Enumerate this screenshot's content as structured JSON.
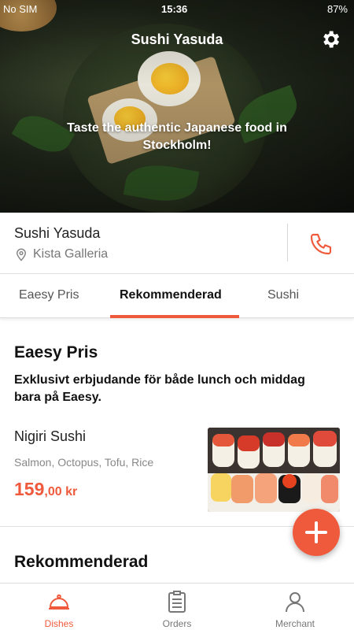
{
  "status_bar": {
    "carrier": "No SIM",
    "time": "15:36",
    "battery": "87%"
  },
  "hero": {
    "title": "Sushi Yasuda",
    "tagline": "Taste the authentic Japanese food in Stockholm!"
  },
  "restaurant": {
    "name": "Sushi Yasuda",
    "location": "Kista Galleria"
  },
  "tabs": [
    {
      "label": "Eaesy Pris",
      "active": false
    },
    {
      "label": "Rekommenderad",
      "active": true
    },
    {
      "label": "Sushi",
      "active": false
    }
  ],
  "sections": [
    {
      "title": "Eaesy Pris",
      "description": "Exklusivt erbjudande för både lunch och middag bara på Eaesy."
    },
    {
      "title": "Rekommenderad"
    }
  ],
  "dish": {
    "name": "Nigiri Sushi",
    "ingredients": "Salmon, Octopus, Tofu, Rice",
    "price_main": "159",
    "price_decimals": ",00 kr"
  },
  "bottom_nav": [
    {
      "label": "Dishes",
      "icon": "cloche-icon",
      "active": true
    },
    {
      "label": "Orders",
      "icon": "clipboard-icon",
      "active": false
    },
    {
      "label": "Merchant",
      "icon": "person-icon",
      "active": false
    }
  ],
  "colors": {
    "accent": "#f05a3c"
  }
}
